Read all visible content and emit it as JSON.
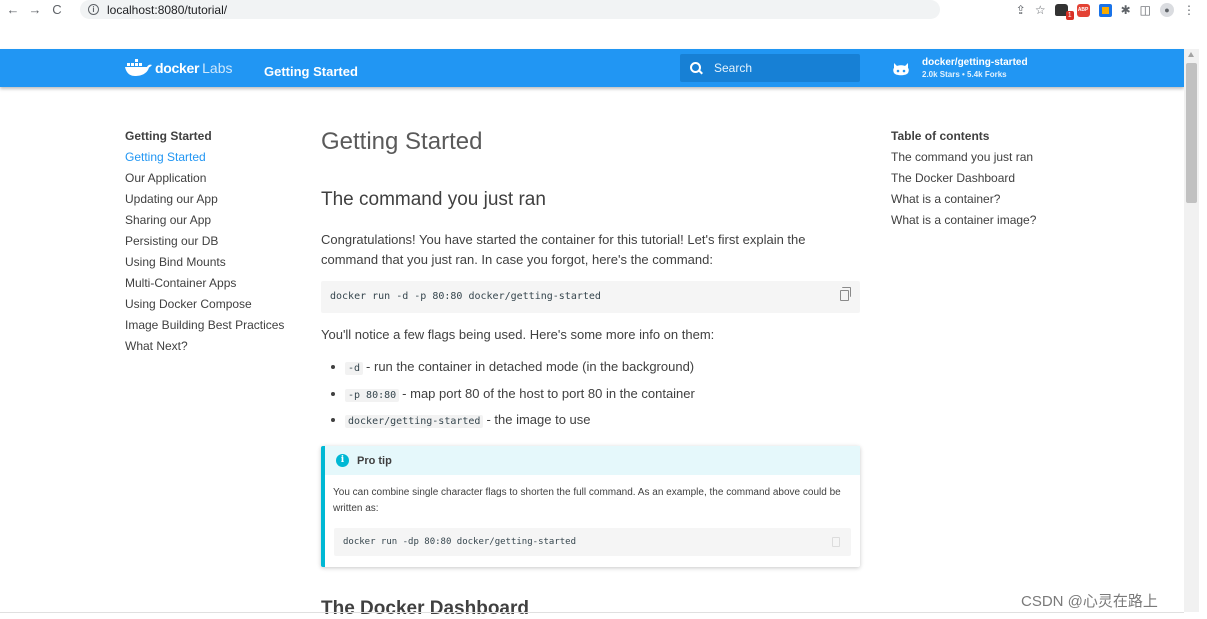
{
  "browser": {
    "back": "←",
    "forward": "→",
    "reload": "C",
    "url": "localhost:8080/tutorial/"
  },
  "header": {
    "logo_docker": "docker",
    "logo_labs": "Labs",
    "title": "Getting Started",
    "search_placeholder": "Search",
    "repo_name": "docker/getting-started",
    "repo_stats": "2.0k Stars • 5.4k Forks"
  },
  "sidebar": {
    "heading": "Getting Started",
    "items": [
      "Getting Started",
      "Our Application",
      "Updating our App",
      "Sharing our App",
      "Persisting our DB",
      "Using Bind Mounts",
      "Multi-Container Apps",
      "Using Docker Compose",
      "Image Building Best Practices",
      "What Next?"
    ]
  },
  "main": {
    "title": "Getting Started",
    "section_heading": "The command you just ran",
    "intro": "Congratulations! You have started the container for this tutorial! Let's first explain the command that you just ran. In case you forgot, here's the command:",
    "command": "docker run -d -p 80:80 docker/getting-started",
    "flags_intro": "You'll notice a few flags being used. Here's some more info on them:",
    "flags": [
      {
        "code": "-d",
        "text": "- run the container in detached mode (in the background)"
      },
      {
        "code": "-p 80:80",
        "text": "- map port 80 of the host to port 80 in the container"
      },
      {
        "code": "docker/getting-started",
        "text": "- the image to use"
      }
    ],
    "tip": {
      "title": "Pro tip",
      "body": "You can combine single character flags to shorten the full command. As an example, the command above could be written as:",
      "command": "docker run -dp 80:80 docker/getting-started"
    },
    "next_heading": "The Docker Dashboard"
  },
  "toc": {
    "heading": "Table of contents",
    "items": [
      "The command you just ran",
      "The Docker Dashboard",
      "What is a container?",
      "What is a container image?"
    ]
  },
  "watermark": "CSDN @心灵在路上"
}
